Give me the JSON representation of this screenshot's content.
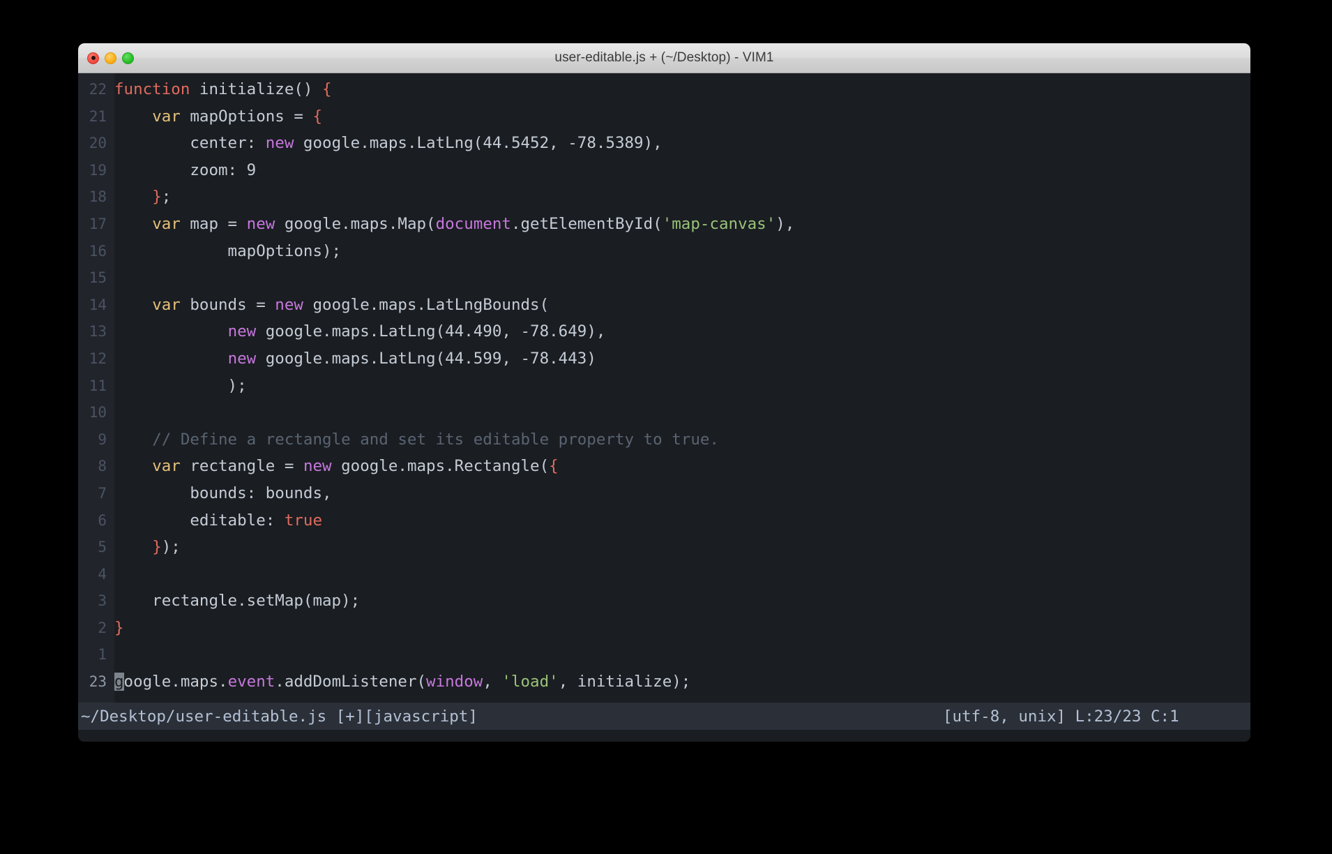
{
  "window": {
    "title": "user-editable.js + (~/Desktop) - VIM1",
    "traffic_lights": {
      "close_label": "close",
      "minimize_label": "minimize",
      "zoom_label": "zoom"
    }
  },
  "editor": {
    "app": "VIM1",
    "filetype": "javascript",
    "lines": [
      {
        "num": "22",
        "tokens": [
          {
            "t": "function",
            "c": "kw"
          },
          {
            "t": " ",
            "c": "plain"
          },
          {
            "t": "initialize",
            "c": "plain"
          },
          {
            "t": "() ",
            "c": "plain"
          },
          {
            "t": "{",
            "c": "brace"
          }
        ]
      },
      {
        "num": "21",
        "tokens": [
          {
            "t": "    ",
            "c": "plain"
          },
          {
            "t": "var",
            "c": "var"
          },
          {
            "t": " mapOptions = ",
            "c": "plain"
          },
          {
            "t": "{",
            "c": "brace"
          }
        ]
      },
      {
        "num": "20",
        "tokens": [
          {
            "t": "        center: ",
            "c": "plain"
          },
          {
            "t": "new",
            "c": "new"
          },
          {
            "t": " google.maps.LatLng(44.5452, -78.5389),",
            "c": "plain"
          }
        ]
      },
      {
        "num": "19",
        "tokens": [
          {
            "t": "        zoom: 9",
            "c": "plain"
          }
        ]
      },
      {
        "num": "18",
        "tokens": [
          {
            "t": "    ",
            "c": "plain"
          },
          {
            "t": "}",
            "c": "brace"
          },
          {
            "t": ";",
            "c": "plain"
          }
        ]
      },
      {
        "num": "17",
        "tokens": [
          {
            "t": "    ",
            "c": "plain"
          },
          {
            "t": "var",
            "c": "var"
          },
          {
            "t": " map = ",
            "c": "plain"
          },
          {
            "t": "new",
            "c": "new"
          },
          {
            "t": " google.maps.Map(",
            "c": "plain"
          },
          {
            "t": "document",
            "c": "new"
          },
          {
            "t": ".getElementById(",
            "c": "plain"
          },
          {
            "t": "'map-canvas'",
            "c": "str"
          },
          {
            "t": "),",
            "c": "plain"
          }
        ]
      },
      {
        "num": "16",
        "tokens": [
          {
            "t": "            mapOptions);",
            "c": "plain"
          }
        ]
      },
      {
        "num": "15",
        "tokens": [
          {
            "t": "",
            "c": "plain"
          }
        ]
      },
      {
        "num": "14",
        "tokens": [
          {
            "t": "    ",
            "c": "plain"
          },
          {
            "t": "var",
            "c": "var"
          },
          {
            "t": " bounds = ",
            "c": "plain"
          },
          {
            "t": "new",
            "c": "new"
          },
          {
            "t": " google.maps.LatLngBounds(",
            "c": "plain"
          }
        ]
      },
      {
        "num": "13",
        "tokens": [
          {
            "t": "            ",
            "c": "plain"
          },
          {
            "t": "new",
            "c": "new"
          },
          {
            "t": " google.maps.LatLng(44.490, -78.649),",
            "c": "plain"
          }
        ]
      },
      {
        "num": "12",
        "tokens": [
          {
            "t": "            ",
            "c": "plain"
          },
          {
            "t": "new",
            "c": "new"
          },
          {
            "t": " google.maps.LatLng(44.599, -78.443)",
            "c": "plain"
          }
        ]
      },
      {
        "num": "11",
        "tokens": [
          {
            "t": "            );",
            "c": "plain"
          }
        ]
      },
      {
        "num": "10",
        "tokens": [
          {
            "t": "",
            "c": "plain"
          }
        ]
      },
      {
        "num": "9",
        "tokens": [
          {
            "t": "    ",
            "c": "plain"
          },
          {
            "t": "// Define a rectangle and set its editable property to true.",
            "c": "com"
          }
        ]
      },
      {
        "num": "8",
        "tokens": [
          {
            "t": "    ",
            "c": "plain"
          },
          {
            "t": "var",
            "c": "var"
          },
          {
            "t": " rectangle = ",
            "c": "plain"
          },
          {
            "t": "new",
            "c": "new"
          },
          {
            "t": " google.maps.Rectangle(",
            "c": "plain"
          },
          {
            "t": "{",
            "c": "brace"
          }
        ]
      },
      {
        "num": "7",
        "tokens": [
          {
            "t": "        bounds: bounds,",
            "c": "plain"
          }
        ]
      },
      {
        "num": "6",
        "tokens": [
          {
            "t": "        editable: ",
            "c": "plain"
          },
          {
            "t": "true",
            "c": "kw"
          }
        ]
      },
      {
        "num": "5",
        "tokens": [
          {
            "t": "    ",
            "c": "plain"
          },
          {
            "t": "}",
            "c": "brace"
          },
          {
            "t": ");",
            "c": "plain"
          }
        ]
      },
      {
        "num": "4",
        "tokens": [
          {
            "t": "",
            "c": "plain"
          }
        ]
      },
      {
        "num": "3",
        "tokens": [
          {
            "t": "    rectangle.setMap(map);",
            "c": "plain"
          }
        ]
      },
      {
        "num": "2",
        "tokens": [
          {
            "t": "}",
            "c": "brace"
          }
        ]
      },
      {
        "num": "1",
        "tokens": [
          {
            "t": "",
            "c": "plain"
          }
        ]
      },
      {
        "num": "23",
        "current": true,
        "tokens": [
          {
            "t": "g",
            "c": "plain cursor"
          },
          {
            "t": "oogle.maps.",
            "c": "plain"
          },
          {
            "t": "event",
            "c": "new"
          },
          {
            "t": ".addDomListener(",
            "c": "plain"
          },
          {
            "t": "window",
            "c": "new"
          },
          {
            "t": ", ",
            "c": "plain"
          },
          {
            "t": "'load'",
            "c": "str"
          },
          {
            "t": ", initialize);",
            "c": "plain"
          }
        ]
      }
    ]
  },
  "statusline": {
    "left": "~/Desktop/user-editable.js [+][javascript]",
    "right": "[utf-8, unix] L:23/23 C:1"
  },
  "colors": {
    "background": "#1a1d21",
    "gutter": "#21252b",
    "statusbar": "#2b3038",
    "keyword": "#e06c5f",
    "variable": "#e5c07b",
    "operator_keyword": "#c678dd",
    "string": "#98c379",
    "comment": "#5a6472",
    "text": "#c4ccd6",
    "line_number": "#4b5263",
    "cursor": "#7d848e",
    "titlebar": "#dcdcdc",
    "titlebar_text": "#3b3b3b"
  }
}
